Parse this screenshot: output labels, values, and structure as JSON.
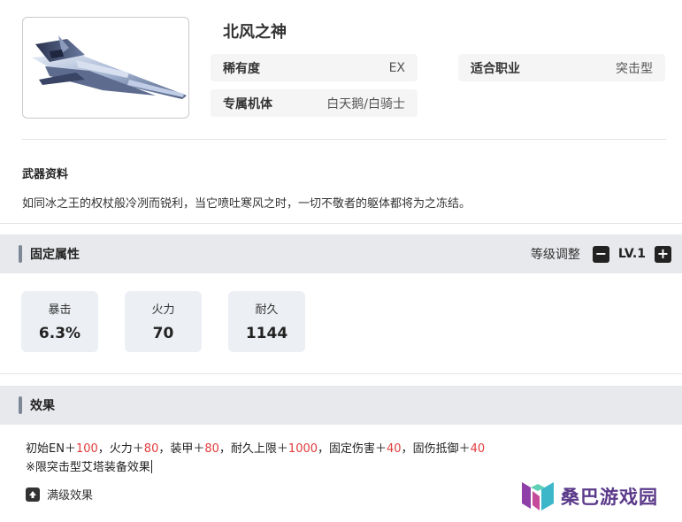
{
  "weapon": {
    "name": "北风之神",
    "rarity": {
      "label": "稀有度",
      "value": "EX"
    },
    "job": {
      "label": "适合职业",
      "value": "突击型"
    },
    "exclusive": {
      "label": "专属机体",
      "value": "白天鹅/白骑士"
    }
  },
  "info": {
    "section_label": "武器资料",
    "description": "如同冰之王的权杖般冷冽而锐利，当它喷吐寒风之时，一切不敬者的躯体都将为之冻结。"
  },
  "fixed_attrs": {
    "title": "固定属性",
    "level_adjust_label": "等级调整",
    "level": "LV.1",
    "minus_symbol": "−",
    "plus_symbol": "+",
    "stats": [
      {
        "label": "暴击",
        "value": "6.3%"
      },
      {
        "label": "火力",
        "value": "70"
      },
      {
        "label": "耐久",
        "value": "1144"
      }
    ]
  },
  "effect": {
    "title": "效果",
    "line1": [
      {
        "text": "初始EN＋",
        "red": false
      },
      {
        "text": "100",
        "red": true
      },
      {
        "text": "，火力＋",
        "red": false
      },
      {
        "text": "80",
        "red": true
      },
      {
        "text": "，装甲＋",
        "red": false
      },
      {
        "text": "80",
        "red": true
      },
      {
        "text": "，耐久上限＋",
        "red": false
      },
      {
        "text": "1000",
        "red": true
      },
      {
        "text": "，固定伤害＋",
        "red": false
      },
      {
        "text": "40",
        "red": true
      },
      {
        "text": "，固伤抵御＋",
        "red": false
      },
      {
        "text": "40",
        "red": true
      }
    ],
    "line2": "※限突击型艾塔装备效果",
    "max_level_label": "满级效果"
  },
  "watermark": {
    "text": "桑巴游戏园"
  },
  "colors": {
    "accent_bar": "#7d8796",
    "highlight_red": "#e23b3b",
    "band_bg": "#e8e9ec",
    "stat_bg": "#eceff3"
  }
}
